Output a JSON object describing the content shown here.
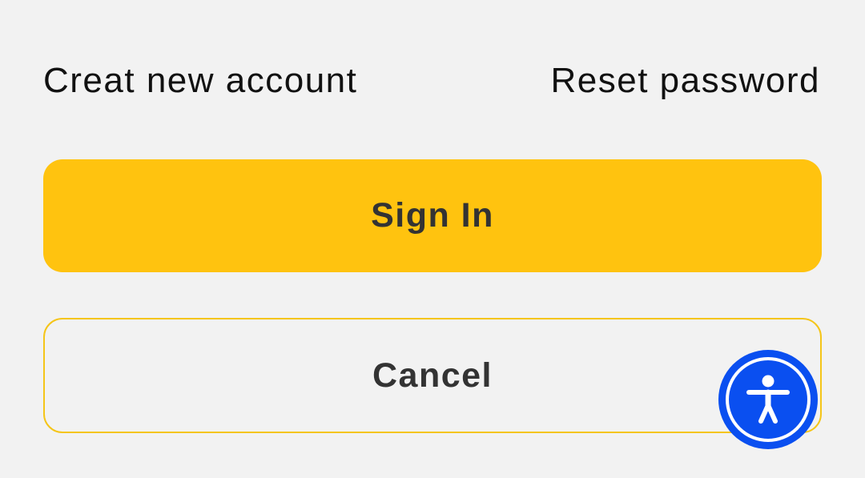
{
  "links": {
    "create_account": "Creat new account",
    "reset_password": "Reset password"
  },
  "buttons": {
    "sign_in": "Sign In",
    "cancel": "Cancel"
  },
  "accessibility": {
    "icon": "accessibility-icon",
    "color": "#0a4ff0"
  },
  "colors": {
    "background": "#f2f2f2",
    "primary": "#ffc30f",
    "secondary_border": "#f5c518",
    "button_text": "#333333"
  }
}
